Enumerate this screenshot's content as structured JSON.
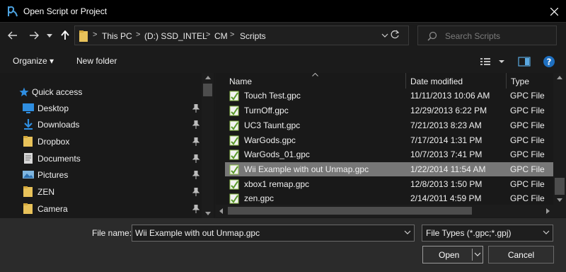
{
  "window": {
    "title": "Open Script or Project"
  },
  "address": {
    "crumbs": [
      "This PC",
      "(D:) SSD_INTEL",
      "CM",
      "Scripts"
    ],
    "separators": [
      ">",
      ">",
      ">",
      ">"
    ]
  },
  "search": {
    "placeholder": "Search Scripts"
  },
  "toolbar": {
    "organize": "Organize ▾",
    "new_folder": "New folder"
  },
  "sidebar": {
    "quick_access": "Quick access",
    "items": [
      {
        "label": "Desktop",
        "icon": "desktop-icon",
        "pinned": true
      },
      {
        "label": "Downloads",
        "icon": "downloads-icon",
        "pinned": true
      },
      {
        "label": "Dropbox",
        "icon": "folder-icon",
        "pinned": true
      },
      {
        "label": "Documents",
        "icon": "documents-icon",
        "pinned": true
      },
      {
        "label": "Pictures",
        "icon": "pictures-icon",
        "pinned": true
      },
      {
        "label": "ZEN",
        "icon": "folder-icon",
        "pinned": true
      },
      {
        "label": "Camera",
        "icon": "folder-icon",
        "pinned": true
      }
    ]
  },
  "columns": {
    "name": "Name",
    "date": "Date modified",
    "type": "Type"
  },
  "files": [
    {
      "name": "Touch Test.gpc",
      "date": "11/11/2013 10:06 AM",
      "type": "GPC File",
      "selected": false
    },
    {
      "name": "TurnOff.gpc",
      "date": "12/29/2013 6:22 PM",
      "type": "GPC File",
      "selected": false
    },
    {
      "name": "UC3 Taunt.gpc",
      "date": "7/21/2013 8:23 AM",
      "type": "GPC File",
      "selected": false
    },
    {
      "name": "WarGods.gpc",
      "date": "7/17/2014 1:31 PM",
      "type": "GPC File",
      "selected": false
    },
    {
      "name": "WarGods_01.gpc",
      "date": "10/7/2013 7:41 PM",
      "type": "GPC File",
      "selected": false
    },
    {
      "name": "Wii Example with out Unmap.gpc",
      "date": "1/22/2014 11:54 AM",
      "type": "GPC File",
      "selected": true
    },
    {
      "name": "xbox1 remap.gpc",
      "date": "12/8/2013 1:50 PM",
      "type": "GPC File",
      "selected": false
    },
    {
      "name": "zen.gpc",
      "date": "2/14/2011 4:59 PM",
      "type": "GPC File",
      "selected": false
    }
  ],
  "bottom": {
    "filename_label": "File name:",
    "filename_value": "Wii Example with out Unmap.gpc",
    "filetype_value": "File Types (*.gpc;*.gpj)",
    "open_label": "Open",
    "cancel_label": "Cancel"
  },
  "colors": {
    "selection": "#777777",
    "accent": "#3a96dd",
    "folder": "#e8c25a",
    "file_icon": "#8fc04a"
  }
}
